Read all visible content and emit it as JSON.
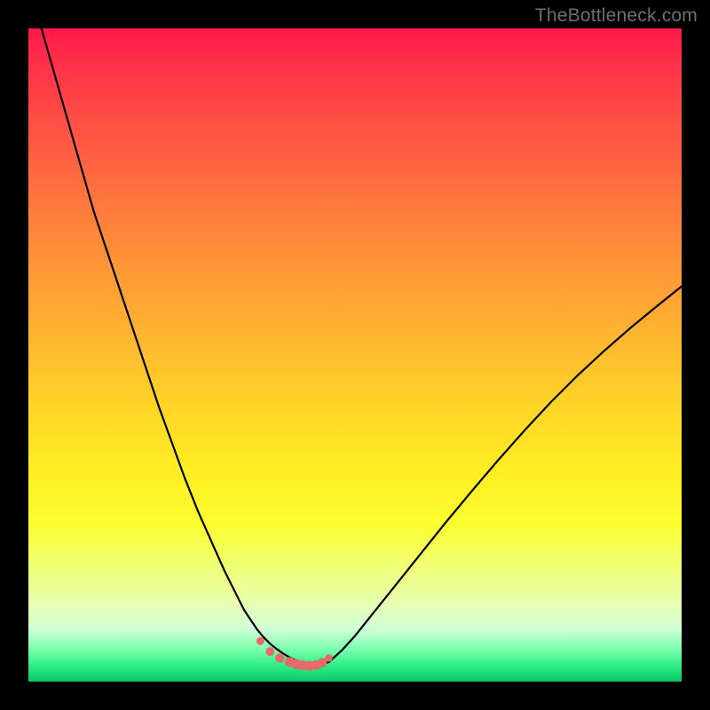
{
  "watermark": {
    "text": "TheBottleneck.com"
  },
  "colors": {
    "frame": "#000000",
    "curve_stroke": "#000000",
    "marker_fill": "#e66a6a",
    "marker_stroke": "#d85a5a"
  },
  "chart_data": {
    "type": "line",
    "title": "",
    "xlabel": "",
    "ylabel": "",
    "xlim": [
      0,
      100
    ],
    "ylim": [
      0,
      100
    ],
    "grid": false,
    "series": [
      {
        "name": "bottleneck-curve",
        "x": [
          0,
          2,
          4,
          6,
          8,
          10,
          12,
          14,
          16,
          18,
          20,
          22,
          24,
          26,
          28,
          30,
          31,
          32,
          33,
          34,
          35,
          36,
          37,
          38,
          39,
          40,
          41,
          42,
          43,
          44,
          46,
          48,
          50,
          52,
          56,
          60,
          64,
          68,
          72,
          76,
          80,
          84,
          88,
          92,
          96,
          100
        ],
        "y": [
          108,
          100,
          93,
          86,
          79,
          72,
          66,
          60,
          54,
          48,
          42,
          36.5,
          31,
          26,
          21.5,
          17,
          15,
          13,
          11,
          9.5,
          8,
          6.8,
          5.8,
          5,
          4.3,
          3.7,
          3.2,
          2.8,
          2.4,
          2.3,
          3,
          4.8,
          7,
          9.5,
          14.5,
          19.5,
          24.5,
          29.3,
          34,
          38.5,
          42.8,
          46.8,
          50.5,
          54,
          57.3,
          60.5
        ]
      }
    ],
    "markers": {
      "name": "highlight-band",
      "x": [
        35.5,
        37,
        38.5,
        40,
        41,
        42,
        43,
        44,
        45,
        46
      ],
      "y": [
        6.2,
        4.6,
        3.6,
        3,
        2.7,
        2.5,
        2.4,
        2.5,
        2.9,
        3.6
      ],
      "r": [
        4.5,
        5,
        5.3,
        5.6,
        5.6,
        5.6,
        5.6,
        5.6,
        5.3,
        4.2
      ]
    }
  }
}
